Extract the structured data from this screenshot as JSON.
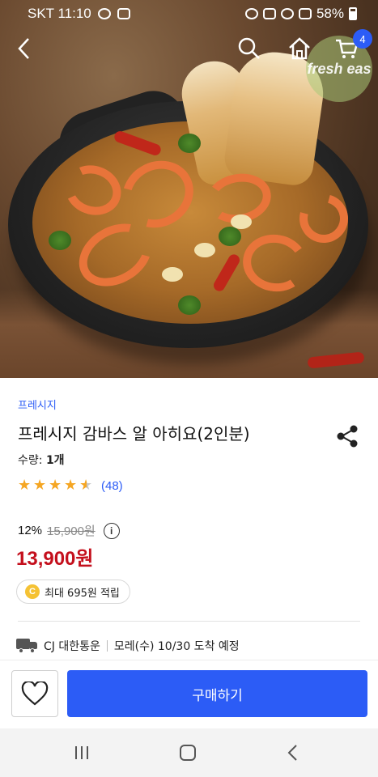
{
  "status_bar": {
    "carrier_time": "SKT 11:10",
    "battery": "58%"
  },
  "nav": {
    "cart_count": "4",
    "logo_text": "fresh eas"
  },
  "product": {
    "brand": "프레시지",
    "title": "프레시지 감바스 알 아히요(2인분)",
    "quantity_label": "수량:",
    "quantity_value": "1개",
    "rating": 4.5,
    "review_count": "(48)",
    "discount": "12%",
    "original_price": "15,900원",
    "sale_price": "13,900원",
    "points_coin": "C",
    "points_text": "최대 695원 적립",
    "delivery_company": "CJ 대한통운",
    "delivery_eta": "모레(수) 10/30 도착 예정"
  },
  "actions": {
    "buy_label": "구매하기"
  },
  "colors": {
    "accent": "#2c5cf6",
    "price": "#c40f1c",
    "star": "#f5a623"
  },
  "icons": {
    "back": "chevron-left-icon",
    "search": "search-icon",
    "home": "home-icon",
    "cart": "cart-icon",
    "share": "share-icon",
    "wishlist": "heart-icon",
    "info": "info-icon"
  }
}
